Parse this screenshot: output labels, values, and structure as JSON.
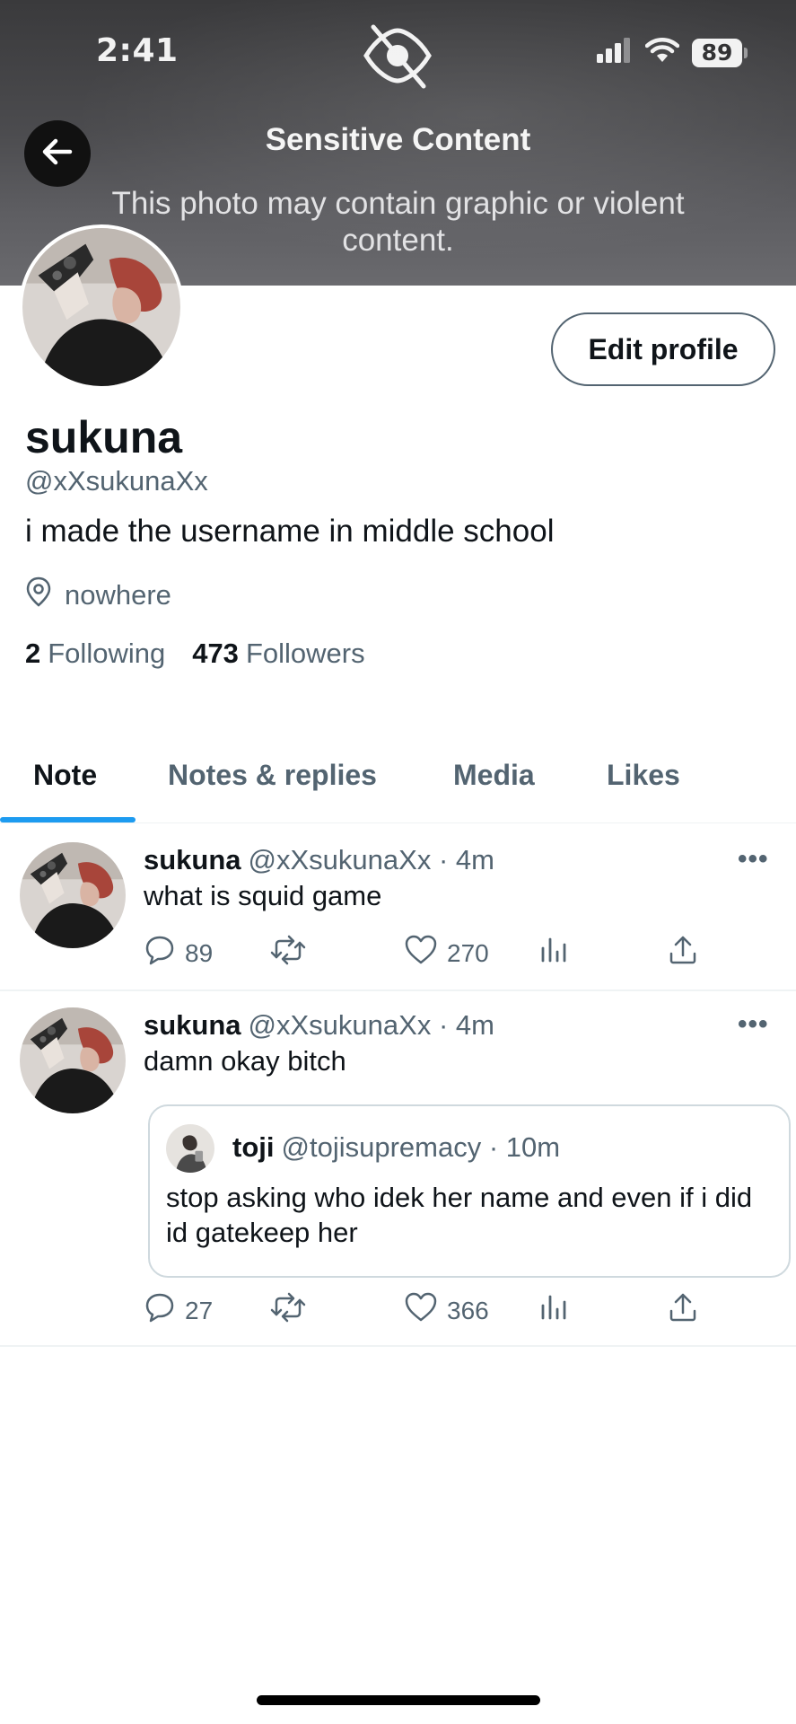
{
  "status_bar": {
    "time": "2:41",
    "battery": "89"
  },
  "banner": {
    "title": "Sensitive Content",
    "description": "This photo may contain graphic or violent content."
  },
  "profile": {
    "display_name": "sukuna",
    "handle": "@xXsukunaXx",
    "bio": "i made the username in middle school",
    "location": "nowhere",
    "following_count": "2",
    "following_label": "Following",
    "followers_count": "473",
    "followers_label": "Followers",
    "edit_button": "Edit profile"
  },
  "tabs": [
    {
      "label": "Note",
      "active": true
    },
    {
      "label": "Notes & replies",
      "active": false
    },
    {
      "label": "Media",
      "active": false
    },
    {
      "label": "Likes",
      "active": false
    }
  ],
  "posts": [
    {
      "author": "sukuna",
      "handle": "@xXsukunaXx",
      "time": "· 4m",
      "text": "what is squid game",
      "replies": "89",
      "likes": "270"
    },
    {
      "author": "sukuna",
      "handle": "@xXsukunaXx",
      "time": "· 4m",
      "text": "damn okay bitch",
      "replies": "27",
      "likes": "366",
      "quote": {
        "author": "toji",
        "handle": "@tojisupremacy",
        "time": "· 10m",
        "text": "stop asking who idek her name and even if i did id gatekeep her"
      }
    }
  ],
  "icons": {
    "back": "arrow-left-icon",
    "hidden": "eye-slash-icon",
    "location": "map-pin-icon",
    "reply": "comment-icon",
    "repost": "repost-icon",
    "like": "heart-icon",
    "views": "bar-chart-icon",
    "share": "share-icon",
    "more": "ellipsis-icon"
  },
  "colors": {
    "accent": "#1d9bf0",
    "secondary_text": "#536471",
    "primary_text": "#0f1419"
  }
}
